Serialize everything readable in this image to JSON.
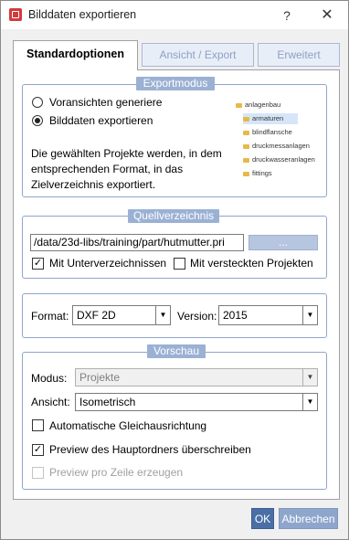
{
  "window": {
    "title": "Bilddaten exportieren",
    "help_glyph": "?",
    "close_glyph": "✕",
    "icon": "app-icon"
  },
  "tabs": [
    {
      "label": "Standardoptionen",
      "active": true
    },
    {
      "label": "Ansicht / Export",
      "active": false
    },
    {
      "label": "Erweitert",
      "active": false
    }
  ],
  "exportmodus": {
    "legend": "Exportmodus",
    "options": [
      {
        "label": "Voransichten generiere",
        "checked": false
      },
      {
        "label": "Bilddaten exportieren",
        "checked": true
      }
    ],
    "description": "Die gewählten Projekte werden, in dem entsprechenden Format, in das Zielverzeichnis exportiert.",
    "tree": [
      {
        "label": "anlagenbau",
        "level": 0,
        "selected": false
      },
      {
        "label": "armaturen",
        "level": 1,
        "selected": true
      },
      {
        "label": "blindflansche",
        "level": 1,
        "selected": false
      },
      {
        "label": "druckmessanlagen",
        "level": 1,
        "selected": false
      },
      {
        "label": "druckwasseranlagen",
        "level": 1,
        "selected": false
      },
      {
        "label": "fittings",
        "level": 1,
        "selected": false
      }
    ]
  },
  "quellverzeichnis": {
    "legend": "Quellverzeichnis",
    "path": "/data/23d-libs/training/part/hutmutter.pri",
    "browse_label": "...",
    "subdirs_label": "Mit Unterverzeichnissen",
    "subdirs_checked": true,
    "hidden_label": "Mit versteckten Projekten",
    "hidden_checked": false
  },
  "format": {
    "format_label": "Format:",
    "format_value": "DXF 2D",
    "version_label": "Version:",
    "version_value": "2015"
  },
  "vorschau": {
    "legend": "Vorschau",
    "modus_label": "Modus:",
    "modus_value": "Projekte",
    "ansicht_label": "Ansicht:",
    "ansicht_value": "Isometrisch",
    "auto_label": "Automatische Gleichausrichtung",
    "auto_checked": false,
    "overwrite_label": "Preview des Hauptordners überschreiben",
    "overwrite_checked": true,
    "perline_label": "Preview pro Zeile erzeugen",
    "perline_checked": false
  },
  "footer": {
    "ok_label": "OK",
    "cancel_label": "Abbrechen"
  },
  "colors": {
    "accent": "#4a6fa6",
    "legend_bg": "#9bb1d4",
    "group_border": "#8ea6c8"
  }
}
